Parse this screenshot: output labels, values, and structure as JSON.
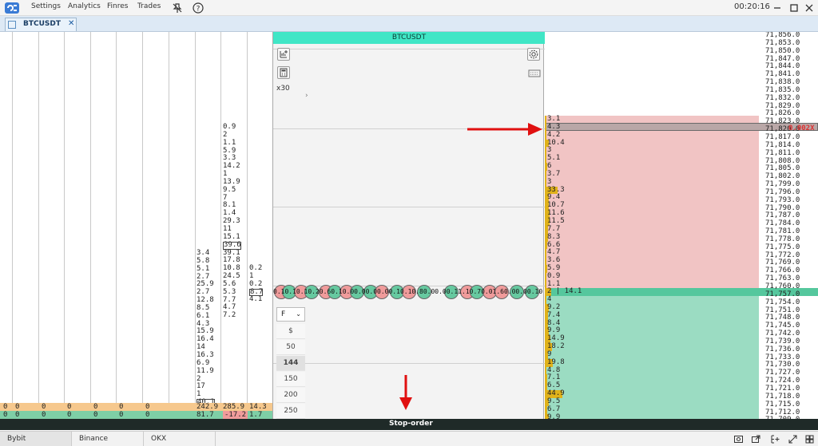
{
  "menu": {
    "settings": "Settings",
    "analytics": "Analytics",
    "finres": "Finres",
    "trades": "Trades"
  },
  "icons": {
    "logo": "app-logo-icon",
    "pin": "pin-off-icon",
    "help": "help-icon",
    "minimize": "minimize-icon",
    "maximize": "maximize-icon",
    "close": "close-icon"
  },
  "clock": "00:20:16",
  "tab": {
    "label": "BTCUSDT",
    "close": "✕"
  },
  "center": {
    "symbol": "BTCUSDT",
    "multiplier": "x30",
    "bubble_text": "0.10.10.10.20.60.10.00.00.00.00.10.10.80.00.00.11.10.70.01.60.00.00.10",
    "select_value": "F",
    "select_chevron": "⌄",
    "currency": "$",
    "quantities": [
      "50",
      "144",
      "150",
      "200",
      "250"
    ],
    "selected_quantity": "144",
    "side_arrow": "›"
  },
  "left_columns": {
    "col8": [
      "3.4",
      "5.8",
      "5.1",
      "2.7",
      "25.9",
      "2.7",
      "12.8",
      "8.5",
      "6.1",
      "4.3",
      "15.9",
      "16.4",
      "14",
      "16.3",
      "6.9",
      "11.9",
      "2",
      "17",
      "1",
      "40.1"
    ],
    "col9": [
      "0.9",
      "2",
      "1.1",
      "5.9",
      "3.3",
      "14.2",
      "1",
      "13.9",
      "9.5",
      "7",
      "8.1",
      "1.4",
      "29.3",
      "11",
      "15.1",
      "39.6",
      "39.1",
      "17.8",
      "10.8",
      "24.5",
      "5.6",
      "5.3",
      "7.7",
      "4.7",
      "7.2"
    ],
    "col10": [
      "0.2",
      "1",
      "0.2",
      "8.7",
      "4.1"
    ],
    "footer_row1": [
      "0",
      "0",
      "0",
      "0",
      "0",
      "0",
      "0",
      "242.9",
      "285.9",
      "14.3"
    ],
    "footer_row2": [
      "0",
      "0",
      "0",
      "0",
      "0",
      "0",
      "0",
      "81.7",
      "-17.2",
      "1.7"
    ]
  },
  "ladder": {
    "prices": [
      "71,856.0",
      "71,853.0",
      "71,850.0",
      "71,847.0",
      "71,844.0",
      "71,841.0",
      "71,838.0",
      "71,835.0",
      "71,832.0",
      "71,829.0",
      "71,826.0",
      "71,823.0",
      "71,820.0",
      "71,817.0",
      "71,814.0",
      "71,811.0",
      "71,808.0",
      "71,805.0",
      "71,802.0",
      "71,799.0",
      "71,796.0",
      "71,793.0",
      "71,790.0",
      "71,787.0",
      "71,784.0",
      "71,781.0",
      "71,778.0",
      "71,775.0",
      "71,772.0",
      "71,769.0",
      "71,766.0",
      "71,763.0",
      "71,760.0",
      "71,757.0",
      "71,754.0",
      "71,751.0",
      "71,748.0",
      "71,745.0",
      "71,742.0",
      "71,739.0",
      "71,736.0",
      "71,733.0",
      "71,730.0",
      "71,727.0",
      "71,724.0",
      "71,721.0",
      "71,718.0",
      "71,715.0",
      "71,712.0",
      "71,709.0"
    ],
    "asks": [
      "3.1",
      "4.3",
      "4.2",
      "10.4",
      "3",
      "5.1",
      "6",
      "3.7",
      "3",
      "33.3",
      "9.4",
      "10.7",
      "11.6",
      "11.5",
      "7.7",
      "8.3",
      "6.6",
      "4.7",
      "3.6",
      "5.9",
      "0.9",
      "1.1"
    ],
    "mid": "2 | 14.1",
    "bids": [
      "4",
      "9.2",
      "7.4",
      "8.4",
      "9.9",
      "14.9",
      "18.2",
      "9",
      "19.8",
      "4.8",
      "7.1",
      "6.5",
      "44.9",
      "9.5",
      "6.7",
      "9.9"
    ],
    "order_tag": "0.002X"
  },
  "stop_order": "Stop-order",
  "exchanges": [
    "Bybit",
    "Binance",
    "OKX"
  ]
}
